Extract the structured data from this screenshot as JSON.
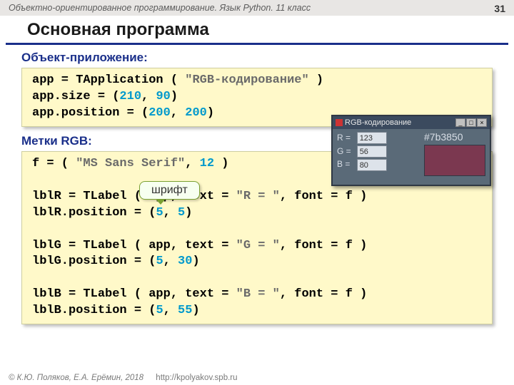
{
  "top": {
    "course": "Объектно-ориентированное программирование. Язык Python. 11 класс",
    "page": "31"
  },
  "title": "Основная программа",
  "sec1": "Объект-приложение:",
  "code1": {
    "l1a": "app = TApplication ( ",
    "l1s": "\"RGB-кодирование\"",
    "l1b": " )",
    "l2a": "app.size = (",
    "l2n1": "210",
    "l2c": ", ",
    "l2n2": "90",
    "l2b": ")",
    "l3a": "app.position = (",
    "l3n1": "200",
    "l3c": ", ",
    "l3n2": "200",
    "l3b": ")"
  },
  "sec2": "Метки RGB:",
  "callout": "шрифт",
  "code2": {
    "fa": "f = ( ",
    "fs": "\"MS Sans Serif\"",
    "fc": ", ",
    "fn": "12",
    "fb": " )",
    "r1a": "lblR = TLabel ( app, text = ",
    "r1s": "\"R = \"",
    "r1b": ", font = f )",
    "r2a": "lblR.position = (",
    "r2n1": "5",
    "r2c": ", ",
    "r2n2": "5",
    "r2b": ")",
    "g1a": "lblG = TLabel ( app, text = ",
    "g1s": "\"G = \"",
    "g1b": ", font = f )",
    "g2a": "lblG.position = (",
    "g2n1": "5",
    "g2c": ", ",
    "g2n2": "30",
    "g2b": ")",
    "b1a": "lblB = TLabel ( app, text = ",
    "b1s": "\"B = \"",
    "b1b": ", font = f )",
    "b2a": "lblB.position = (",
    "b2n1": "5",
    "b2c": ", ",
    "b2n2": "55",
    "b2b": ")"
  },
  "win": {
    "title": "RGB-кодирование",
    "lblR": "R =",
    "lblG": "G =",
    "lblB": "B =",
    "vR": "123",
    "vG": "56",
    "vB": "80",
    "hex": "#7b3850",
    "min": "_",
    "max": "□",
    "close": "×"
  },
  "footer": {
    "copy": "© К.Ю. Поляков, Е.А. Ерёмин, 2018",
    "url": "http://kpolyakov.spb.ru"
  }
}
